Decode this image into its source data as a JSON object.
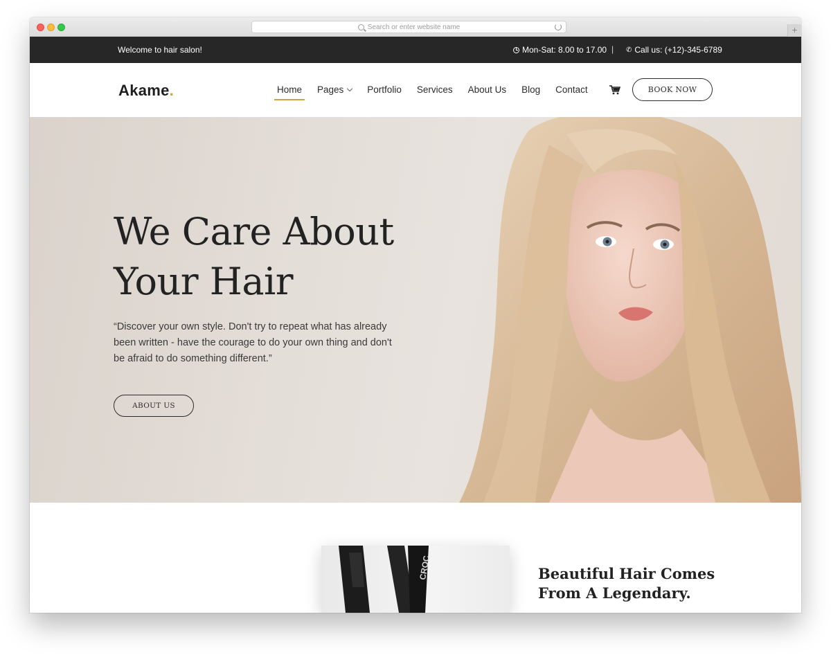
{
  "browser": {
    "address_placeholder": "Search or enter website name",
    "new_tab_label": "+"
  },
  "topbar": {
    "welcome": "Welcome to hair salon!",
    "hours": "Mon-Sat: 8.00 to 17.00",
    "separator": "|",
    "phone": "Call us: (+12)-345-6789"
  },
  "header": {
    "logo_text": "Akame",
    "logo_dot": ".",
    "nav": [
      {
        "label": "Home",
        "active": true
      },
      {
        "label": "Pages"
      },
      {
        "label": "Portfolio"
      },
      {
        "label": "Services"
      },
      {
        "label": "About Us"
      },
      {
        "label": "Blog"
      },
      {
        "label": "Contact"
      }
    ],
    "book_label": "BOOK NOW"
  },
  "hero": {
    "title_line1": "We Care About",
    "title_line2": "Your Hair",
    "quote_line1": "“Discover your own style. Don't try to repeat what has already",
    "quote_line2": "been written - have the courage to do your own thing and don't",
    "quote_line3": "be afraid to do something different.”",
    "button_label": "ABOUT US"
  },
  "section2": {
    "title_line1": "Beautiful Hair Comes",
    "title_line2": "From A Legendary.",
    "product_brand": "CROC"
  },
  "colors": {
    "accent": "#c9a53c",
    "topbar_bg": "#272727",
    "text_dark": "#222222",
    "hero_bg": "#e4ded8"
  }
}
